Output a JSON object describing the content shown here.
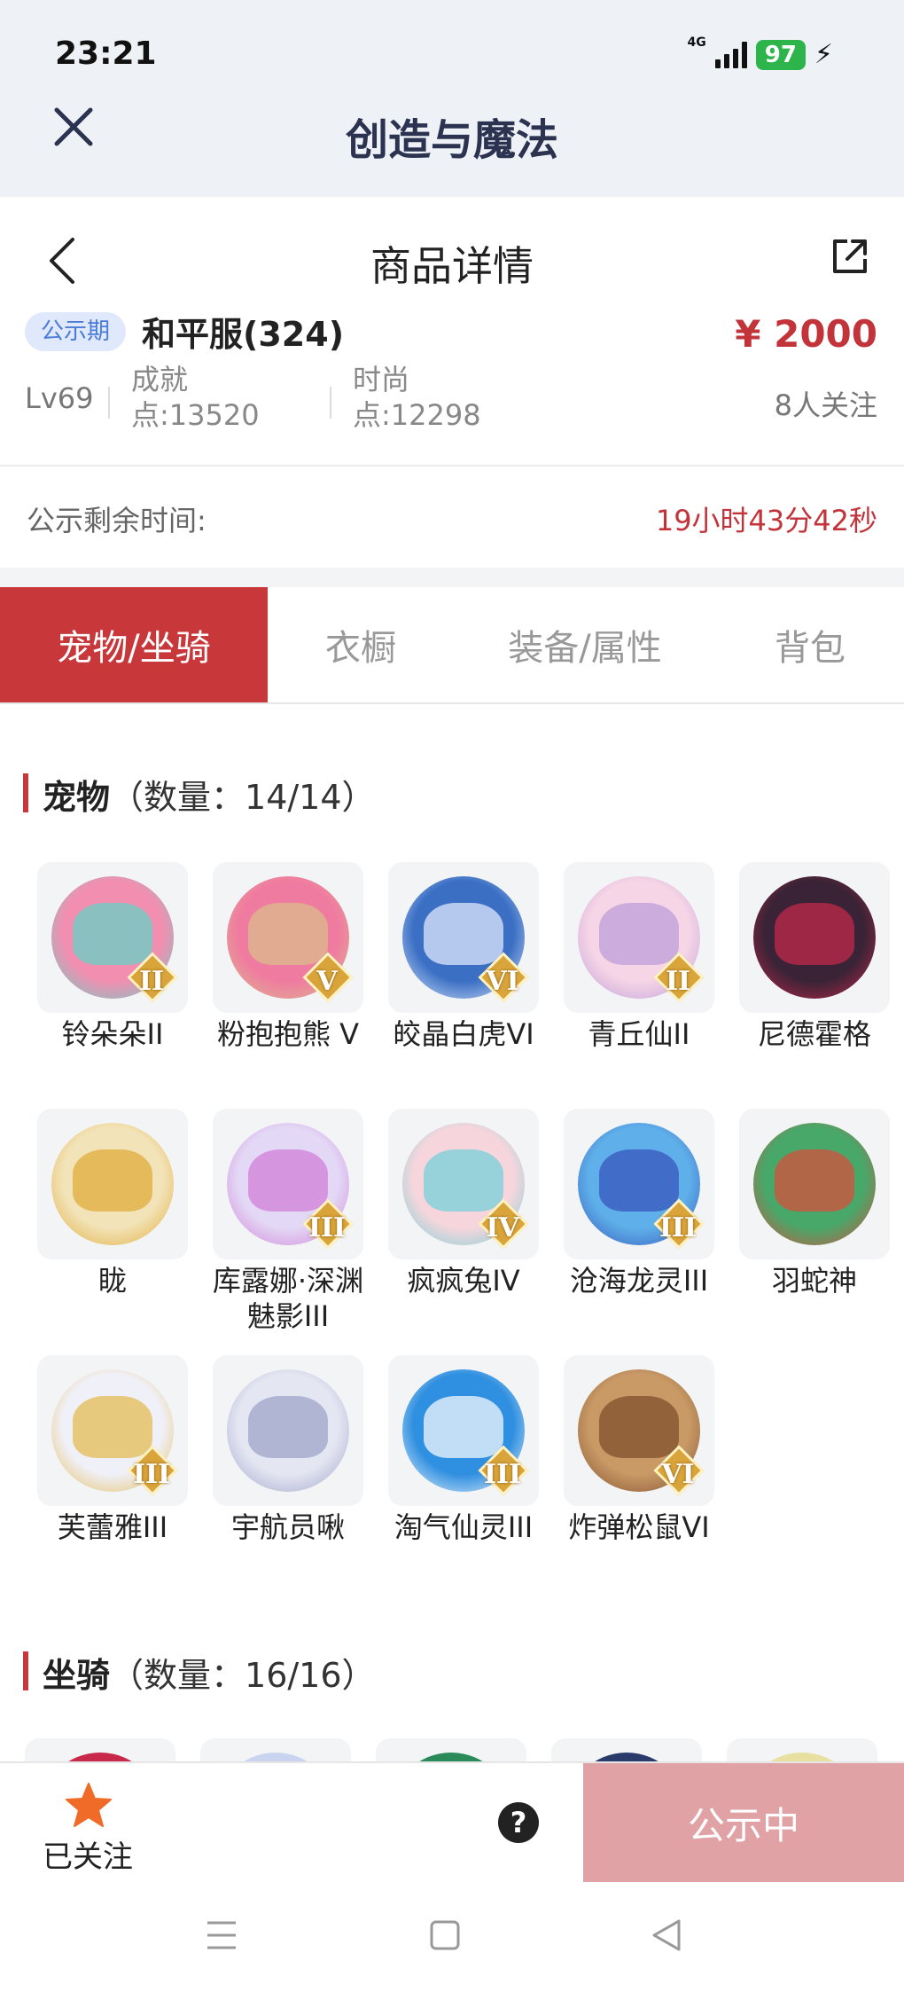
{
  "status": {
    "time": "23:21",
    "network": "4G",
    "battery": "97"
  },
  "app": {
    "title": "创造与魔法"
  },
  "nav": {
    "title": "商品详情"
  },
  "product": {
    "badge": "公示期",
    "server": "和平服(324)",
    "price": "¥ 2000",
    "level": "Lv69",
    "achievement": "成就点:13520",
    "fashion": "时尚点:12298",
    "followers": "8人关注"
  },
  "remain": {
    "label": "公示剩余时间:",
    "value": "19小时43分42秒"
  },
  "tabs": [
    {
      "label": "宠物/坐骑",
      "active": true
    },
    {
      "label": "衣橱",
      "active": false
    },
    {
      "label": "装备/属性",
      "active": false
    },
    {
      "label": "背包",
      "active": false
    }
  ],
  "pets_section": {
    "name": "宠物",
    "count": "（数量：14/14）"
  },
  "pets": [
    {
      "name": "铃朵朵II",
      "rank": "II",
      "color": "#f28fb0",
      "color2": "#5fd4c9"
    },
    {
      "name": "粉抱抱熊 V",
      "rank": "V",
      "color": "#f07ba0",
      "color2": "#d8c08a"
    },
    {
      "name": "皎晶白虎VI",
      "rank": "VI",
      "color": "#3a6fc4",
      "color2": "#e8f0ff"
    },
    {
      "name": "青丘仙II",
      "rank": "II",
      "color": "#f6d5e6",
      "color2": "#b99ad8"
    },
    {
      "name": "尼德霍格",
      "rank": "",
      "color": "#3a2336",
      "color2": "#c8294a"
    },
    {
      "name": "眬",
      "rank": "",
      "color": "#f2e3b8",
      "color2": "#e0a832"
    },
    {
      "name": "库露娜·深渊魅影III",
      "rank": "III",
      "color": "#e3d8f5",
      "color2": "#d07ad6"
    },
    {
      "name": "疯疯兔IV",
      "rank": "IV",
      "color": "#f6d6dc",
      "color2": "#6fd0d8"
    },
    {
      "name": "沧海龙灵III",
      "rank": "III",
      "color": "#5fb0ea",
      "color2": "#3550b8"
    },
    {
      "name": "羽蛇神",
      "rank": "",
      "color": "#47a86a",
      "color2": "#e04a3a"
    },
    {
      "name": "芙蕾雅III",
      "rank": "III",
      "color": "#f0f0f8",
      "color2": "#e3b84a"
    },
    {
      "name": "宇航员啾",
      "rank": "",
      "color": "#e4e6f2",
      "color2": "#9aa0c8"
    },
    {
      "name": "淘气仙灵III",
      "rank": "III",
      "color": "#2f8fe0",
      "color2": "#ffffff"
    },
    {
      "name": "炸弹松鼠VI",
      "rank": "VI",
      "color": "#c99a66",
      "color2": "#7a4a2a"
    }
  ],
  "mounts_section": {
    "name": "坐骑",
    "count": "（数量：16/16）"
  },
  "mounts": [
    {
      "color": "#c8294a"
    },
    {
      "color": "#c8d4f0"
    },
    {
      "color": "#2a8a5a"
    },
    {
      "color": "#2a3a6a"
    },
    {
      "color": "#e8e0a0"
    }
  ],
  "bottom": {
    "follow_label": "已关注",
    "help": "?",
    "cta": "公示中"
  },
  "colors": {
    "accent": "#c8373a",
    "price": "#c2333a",
    "cta": "#e0a2a4"
  }
}
